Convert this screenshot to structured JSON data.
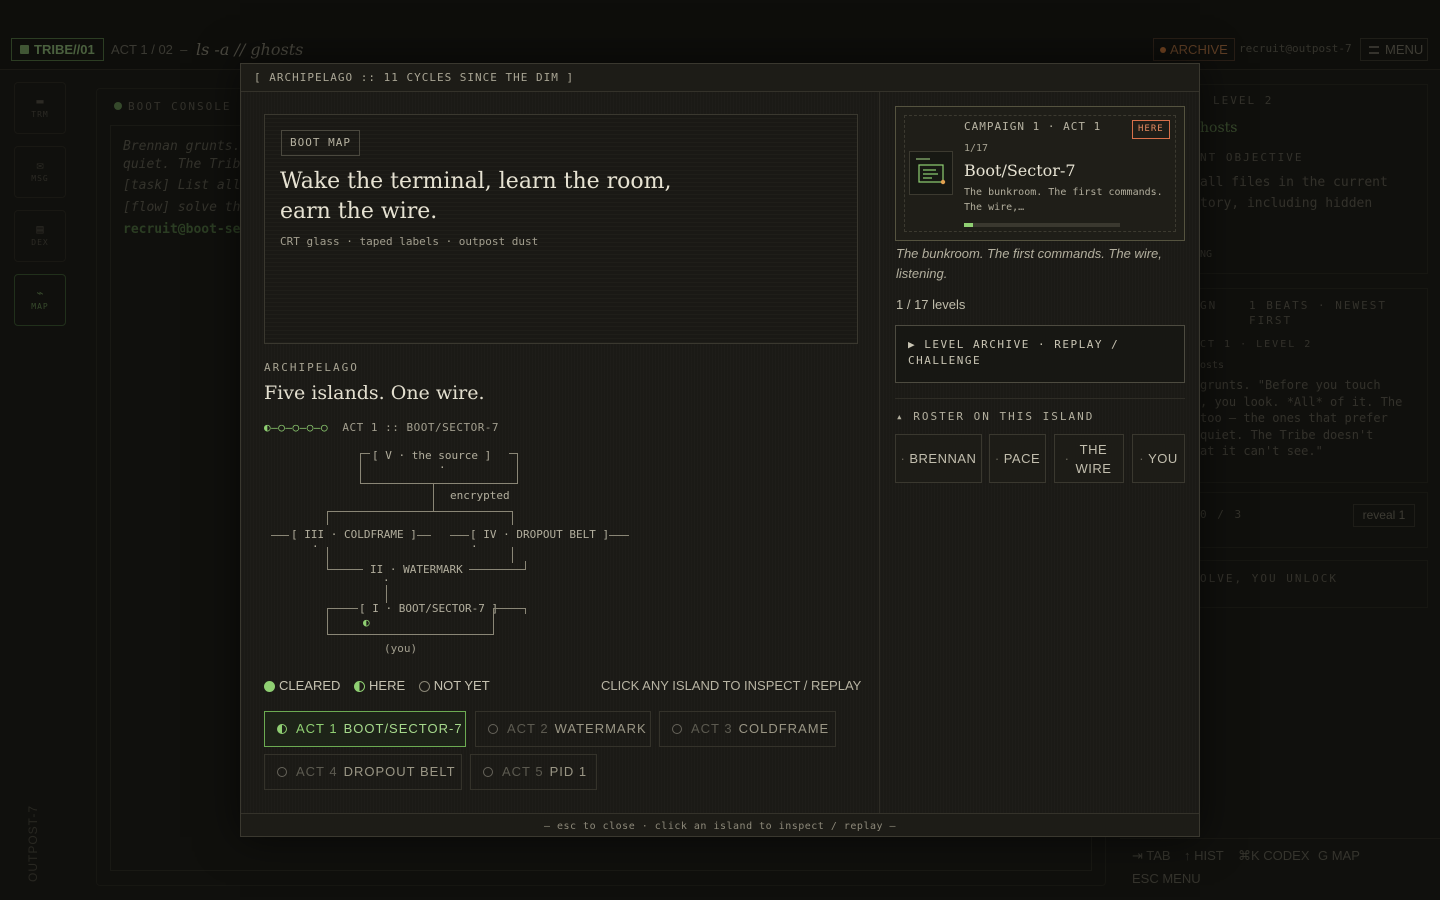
{
  "topbar": {
    "tribe": "TRIBE//01",
    "act": "ACT 1 / 02",
    "sep": "–",
    "command": "ls -a // ghosts",
    "archive": "ARCHIVE",
    "user": "recruit@outpost-7",
    "menu": "MENU"
  },
  "sidebar": {
    "items": [
      {
        "glyph": "▬",
        "label": "TRM"
      },
      {
        "glyph": "✉",
        "label": "MSG"
      },
      {
        "glyph": "▤",
        "label": "DEX"
      },
      {
        "glyph": "⌁",
        "label": "MAP"
      }
    ],
    "vertical": "OUTPOST-7"
  },
  "console": {
    "title": "BOOT CONSOLE ·",
    "lines": [
      "Brennan grunts.",
      "quiet. The Trib",
      "[task] List all",
      "[flow] solve th"
    ],
    "prompt": "recruit@boot-se"
  },
  "right_panel": {
    "level": "LEVEL 2",
    "ghosts": "hosts",
    "objective_label": "NT OBJECTIVE",
    "objective_1": "all files in the current",
    "objective_2": "tory, including hidden",
    "ng": "NG",
    "beats_label": "GN",
    "beats": "1 BEATS · NEWEST",
    "beats_2": "FIRST",
    "beat_loc": "CT 1 · LEVEL 2",
    "beat_sub": "osts",
    "beat_text_1": "grunts. \"Before you touch",
    "beat_text_2": ", you look. *All* of it. The",
    "beat_text_3": " too — the ones that prefer",
    "beat_text_4": "quiet. The Tribe doesn't",
    "beat_text_5": "at it can't see.\"",
    "hints": "0 / 3",
    "reveal": "reveal 1",
    "unlock": "OLVE, YOU UNLOCK"
  },
  "hotkeys": {
    "tab": "⇥ TAB",
    "hist": "↑ HIST",
    "codex": "⌘K CODEX",
    "map": "G MAP",
    "esc": "ESC MENU"
  },
  "modal": {
    "header": "[ ARCHIPELAGO :: 11 CYCLES SINCE THE DIM ]",
    "footer": "— esc to close · click an island to inspect / replay —",
    "bootmap": {
      "tag": "BOOT MAP",
      "title": "Wake the terminal, learn the room, earn the wire.",
      "subtitle": "CRT glass · taped labels · outpost dust"
    },
    "archipelago": {
      "label": "ARCHIPELAGO",
      "title": "Five islands. One wire.",
      "track_glyphs": "◐–○–○–○–○",
      "track_label": "ACT 1 :: BOOT/SECTOR-7"
    },
    "map": {
      "v": "[ V · the source ]",
      "encrypted": "encrypted",
      "iii": "[ III · COLDFRAME ]",
      "iv": "[ IV · DROPOUT BELT ]",
      "ii": "II · WATERMARK",
      "i": "[ I · BOOT/SECTOR-7 ]",
      "you": "(you)",
      "dot_here": "◐",
      "dot": "·"
    },
    "legend": {
      "cleared": "CLEARED",
      "here": "HERE",
      "not_yet": "NOT YET",
      "hint": "CLICK ANY ISLAND TO INSPECT / REPLAY"
    },
    "acts": [
      {
        "num": "ACT 1",
        "name": "BOOT/SECTOR-7"
      },
      {
        "num": "ACT 2",
        "name": "WATERMARK"
      },
      {
        "num": "ACT 3",
        "name": "COLDFRAME"
      },
      {
        "num": "ACT 4",
        "name": "DROPOUT BELT"
      },
      {
        "num": "ACT 5",
        "name": "PID 1"
      }
    ],
    "campaign": {
      "label": "CAMPAIGN 1 · ACT 1",
      "here": "HERE",
      "count": "1/17",
      "title": "Boot/Sector-7",
      "desc": "The bunkroom. The first commands. The wire,…",
      "progress": 0.06
    },
    "description": "The bunkroom. The first commands. The wire, listening.",
    "levels": "1 / 17 levels",
    "archive_toggle": "▶ LEVEL ARCHIVE · REPLAY / CHALLENGE",
    "roster_label": "▴ ROSTER ON THIS ISLAND",
    "roster": [
      "BRENNAN",
      "PACE",
      "THE WIRE",
      "YOU"
    ],
    "colors": {
      "accent": "#8fcf72",
      "here": "#e58a60"
    }
  }
}
